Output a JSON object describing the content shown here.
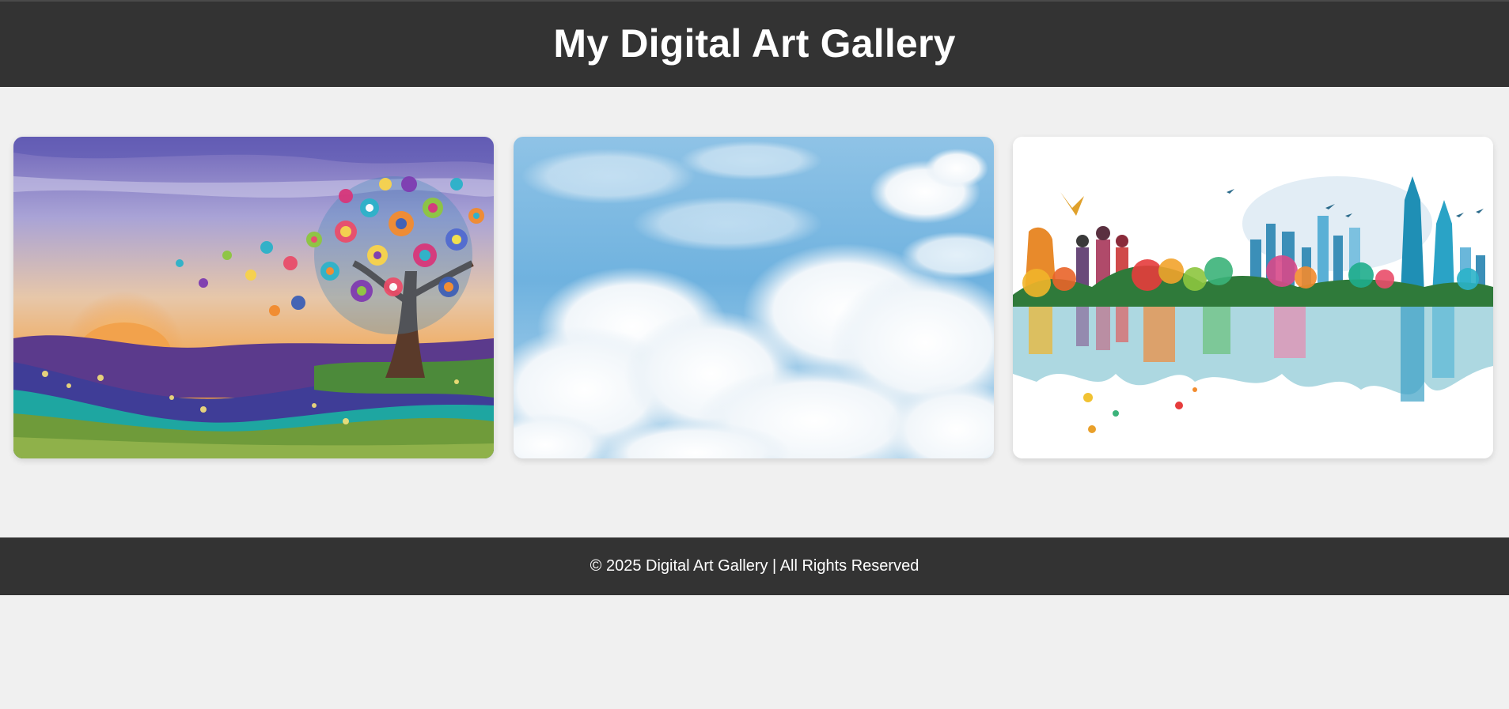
{
  "header": {
    "title": "My Digital Art Gallery"
  },
  "gallery": {
    "artworks": [
      {
        "subject": "colorful-tree-landscape"
      },
      {
        "subject": "blue-sky-clouds"
      },
      {
        "subject": "tropical-city-reflection"
      }
    ]
  },
  "footer": {
    "copyright": "© 2025 Digital Art Gallery | All Rights Reserved"
  },
  "colors": {
    "bar_background": "#333333",
    "page_background": "#f0f0f0",
    "text_light": "#ffffff"
  }
}
